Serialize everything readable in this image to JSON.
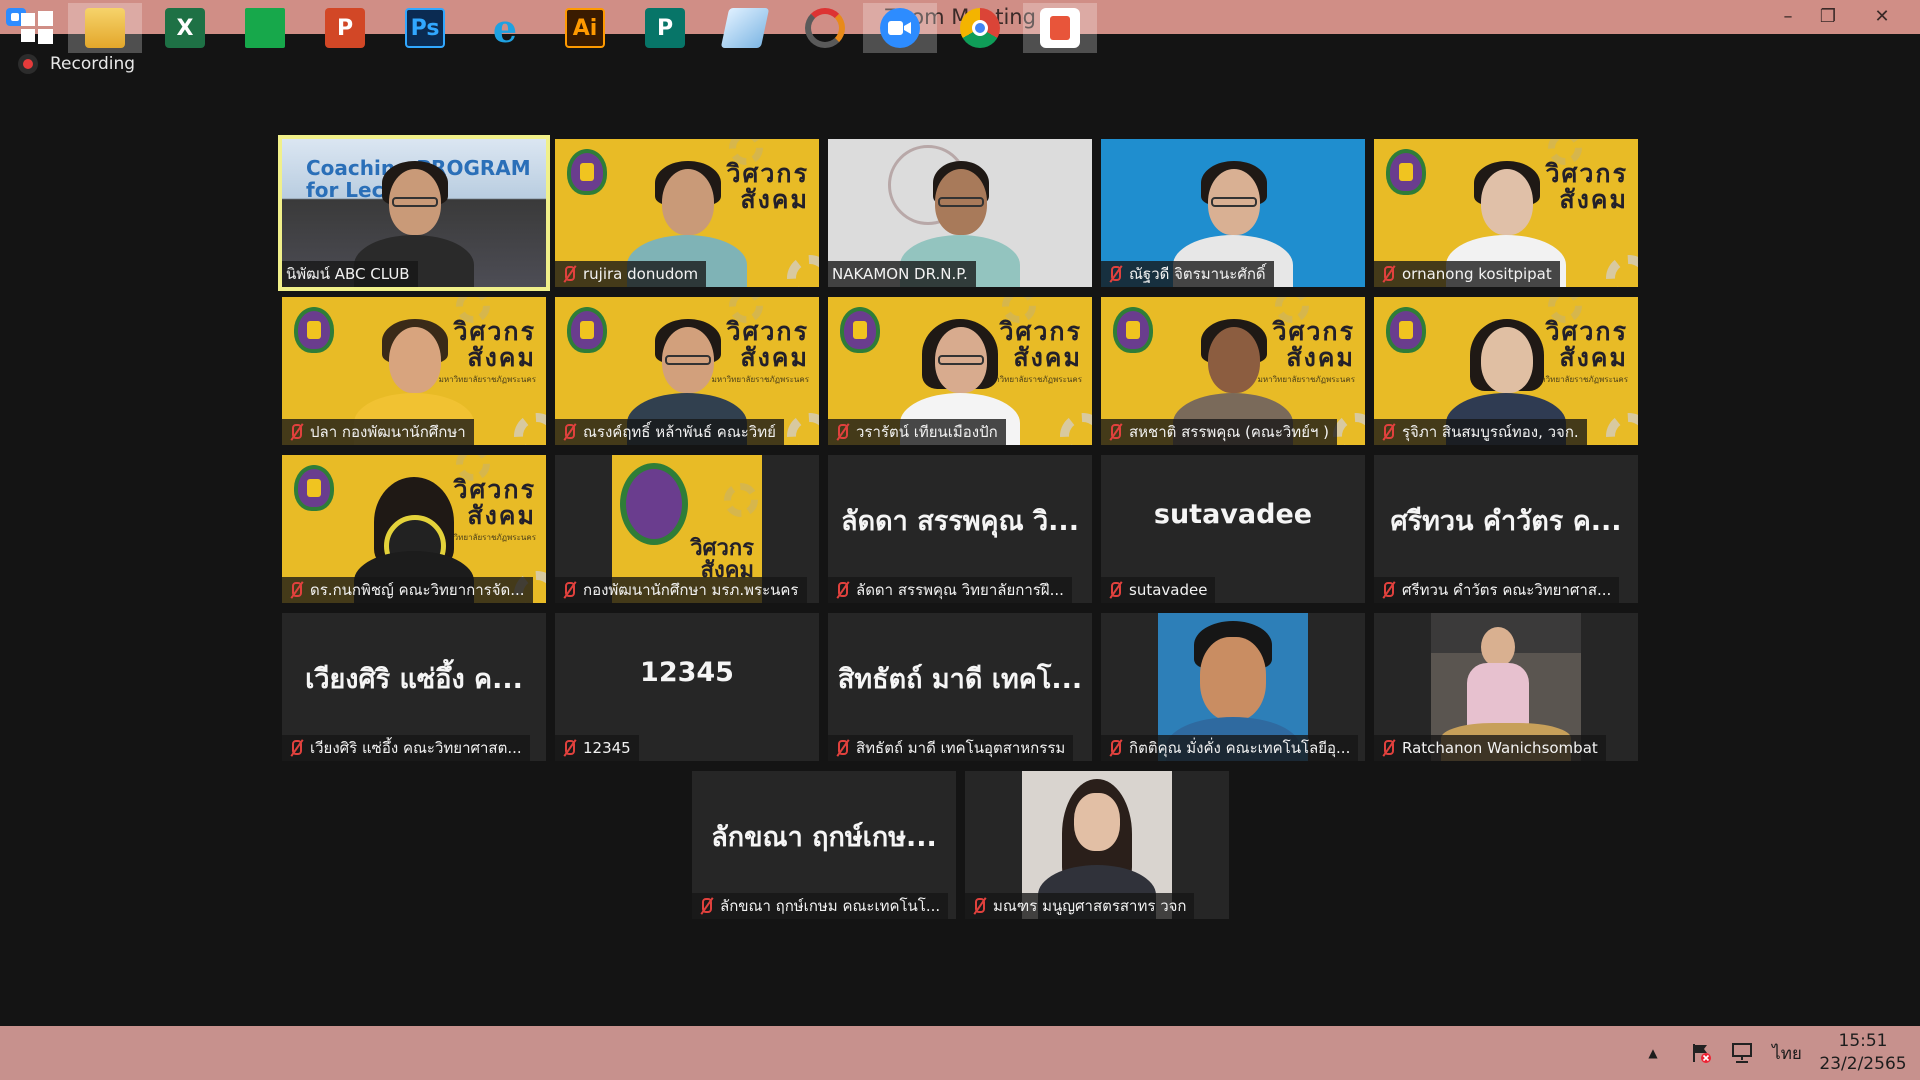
{
  "window": {
    "title": "Zoom Meeting",
    "minimize": "–",
    "restore": "❐",
    "close": "✕"
  },
  "recording": {
    "label": "Recording"
  },
  "participants": [
    {
      "name": "นิพัฒน์ ABC CLUB",
      "video_text": "Coaching PROGRAM for Lecturer"
    },
    {
      "name": "rujira donudom"
    },
    {
      "name": "NAKAMON DR.N.P."
    },
    {
      "name": "ณัฐวดี จิตรมานะศักดิ์"
    },
    {
      "name": "ornanong kositpipat"
    },
    {
      "name": "ปลา กองพัฒนานักศึกษา"
    },
    {
      "name": "ณรงค์ฤทธิ์ หล้าพันธ์ คณะวิทย์"
    },
    {
      "name": "วรารัตน์ เทียนเมืองปัก"
    },
    {
      "name": "สหชาติ สรรพคุณ (คณะวิทย์ฯ )"
    },
    {
      "name": "รุจิภา สินสมบูรณ์ทอง, วจก."
    },
    {
      "name": "ดร.กนกพิชญ์ คณะวิทยาการจัด..."
    },
    {
      "name": "กองพัฒนานักศึกษา มรภ.พระนคร"
    },
    {
      "name": "ลัดดา สรรพคุณ วิทยาลัยการฝึ...",
      "display": "ลัดดา สรรพคุณ วิ..."
    },
    {
      "name": "sutavadee",
      "display": "sutavadee"
    },
    {
      "name": "ศรีทวน คำวัตร คณะวิทยาศาส...",
      "display": "ศรีทวน คำวัตร ค..."
    },
    {
      "name": "เวียงศิริ แซ่อึ้ง คณะวิทยาศาสต...",
      "display": "เวียงศิริ แซ่อึ้ง ค..."
    },
    {
      "name": "12345",
      "display": "12345"
    },
    {
      "name": "สิทธัตถ์ มาดี เทคโนอุตสาหกรรม",
      "display": "สิทธัตถ์ มาดี เทคโ..."
    },
    {
      "name": "กิตติคุณ มั่งคั่ง คณะเทคโนโลยีอุ..."
    },
    {
      "name": "Ratchanon Wanichsombat"
    },
    {
      "name": "ลักขณา ฤกษ์เกษม คณะเทคโนโ...",
      "display": "ลักขณา ฤกษ์เกษ..."
    },
    {
      "name": "มณฑร มนูญศาสตรสาทร วจก"
    }
  ],
  "logo": {
    "line1": "วิศวกร",
    "line2": "สังคม",
    "sub": "มหาวิทยาลัยราชภัฏพระนคร"
  },
  "taskbar": {
    "apps": [
      {
        "icon": "windows-start-icon",
        "label": ""
      },
      {
        "icon": "file-explorer-icon",
        "label": ""
      },
      {
        "icon": "excel-icon",
        "label": "X"
      },
      {
        "icon": "store-icon",
        "label": ""
      },
      {
        "icon": "powerpoint-icon",
        "label": "P"
      },
      {
        "icon": "photoshop-icon",
        "label": "Ps"
      },
      {
        "icon": "internet-explorer-icon",
        "label": "e"
      },
      {
        "icon": "illustrator-icon",
        "label": "Ai"
      },
      {
        "icon": "publisher-icon",
        "label": "P"
      },
      {
        "icon": "notepad-icon",
        "label": ""
      },
      {
        "icon": "photoscape-icon",
        "label": ""
      },
      {
        "icon": "zoom-icon",
        "label": ""
      },
      {
        "icon": "chrome-icon",
        "label": ""
      },
      {
        "icon": "office-icon",
        "label": ""
      }
    ],
    "language": "ไทย",
    "time": "15:51",
    "date": "23/2/2565"
  }
}
